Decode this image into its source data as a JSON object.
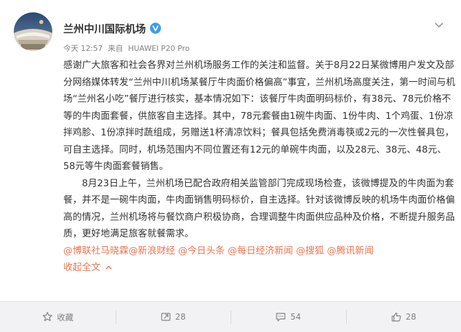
{
  "account": {
    "name": "兰州中川国际机场",
    "verified_icon": "verified-badge-icon"
  },
  "meta": {
    "time": "今天 12:57",
    "source_prefix": "来自",
    "source": "HUAWEI P20 Pro"
  },
  "post": {
    "paragraph1": "感谢广大旅客和社会各界对兰州机场服务工作的关注和监督。关于8月22日某微博用户发文及部分网络媒体转发“兰州中川机场某餐厅牛肉面价格偏高”事宜，兰州机场高度关注，第一时间与机场“兰州名小吃”餐厅进行核实，基本情况如下：该餐厅牛肉面明码标价，有38元、78元价格不等的牛肉面套餐，供旅客自主选择。其中，78元套餐由1碗牛肉面、1份牛肉、1个鸡蛋、1份凉拌鸡胗、1份凉拌时蔬组成，另赠送1杯清凉饮料；餐具包括免费消毒筷或2元的一次性餐具包，可自主选择。同时，机场范围内不同位置还有12元的单碗牛肉面，以及28元、38元、48元、58元等牛肉面套餐销售。",
    "paragraph2": "　　8月23日上午，兰州机场已配合政府相关监管部门完成现场检查，该微博提及的牛肉面为套餐，并不是一碗牛肉面，牛肉面销售明码标价，自主选择。针对该微博反映的机场牛肉面价格偏高的情况，兰州机场将与餐饮商户积极协商，合理调整牛肉面供应品种及价格，不断提升服务品质，更好地满足旅客就餐需求。",
    "mentions": [
      "@博联社马晓霖",
      "@新浪财经",
      "@今日头条",
      "@每日经济新闻",
      "@搜狐",
      "@腾讯新闻"
    ],
    "collapse_label": "收起全文",
    "collapse_icon": "chevron-up-icon"
  },
  "actions": {
    "favorite_label": "收藏",
    "repost_count": "28",
    "comment_count": "54",
    "like_count": "28"
  },
  "colors": {
    "link": "#eb7350",
    "verified": "#3d9ee6",
    "action_bar": "#f2f2f5"
  }
}
